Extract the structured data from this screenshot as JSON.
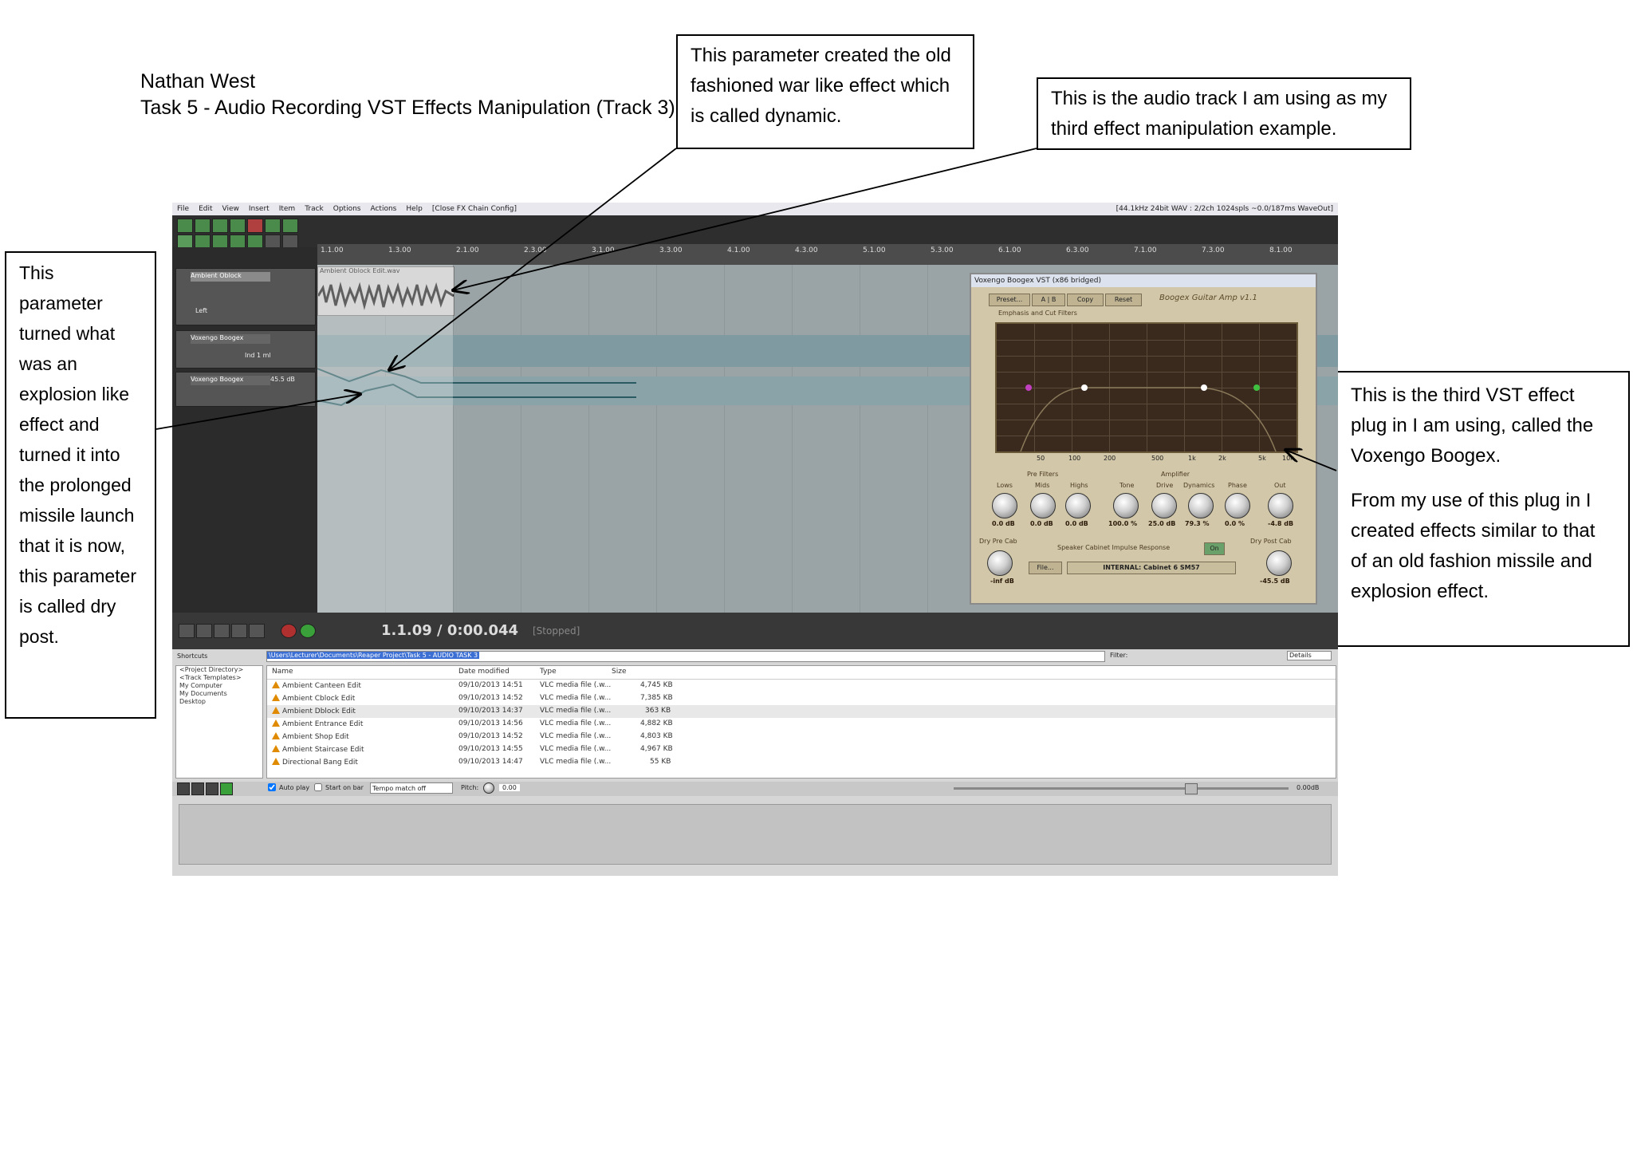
{
  "document": {
    "author": "Nathan West",
    "title": "Task 5 - Audio Recording VST Effects Manipulation (Track 3)"
  },
  "callouts": {
    "dynamic": "This parameter created the old fashioned war like effect which is called dynamic.",
    "audio_track": "This is the audio track I am using as my third effect manipulation example.",
    "dry_post": "This parameter turned what was an explosion like effect and turned it into the prolonged missile launch that it is now, this parameter is called dry post.",
    "plugin_1": "This is the third VST effect plug in I am using, called the Voxengo Boogex.",
    "plugin_2": "From my use of this plug in I created effects similar to that of an old fashion missile and explosion effect."
  },
  "screenshot": {
    "menu": [
      "File",
      "Edit",
      "View",
      "Insert",
      "Item",
      "Track",
      "Options",
      "Actions",
      "Help",
      "[Close FX Chain Config]"
    ],
    "status_right": "[44.1kHz 24bit WAV : 2/2ch 1024spls ~0.0/187ms WaveOut]",
    "ruler": [
      "1.1.00",
      "1.3.00",
      "2.1.00",
      "2.3.00",
      "3.1.00",
      "3.3.00",
      "4.1.00",
      "4.3.00",
      "5.1.00",
      "5.3.00",
      "6.1.00",
      "6.3.00",
      "7.1.00",
      "7.3.00",
      "8.1.00"
    ],
    "item_name": "Ambient Oblock Edit.wav",
    "tracks": [
      {
        "name": "Ambient Oblock",
        "pan": "Left"
      },
      {
        "name": "Voxengo Boogex",
        "value": "Ind 1 ml"
      },
      {
        "name": "Voxengo Boogex",
        "value": "45.5 dB"
      }
    ],
    "transport": {
      "time": "1.1.09 / 0:00.044",
      "status": "[Stopped]"
    },
    "plugin": {
      "title": "Voxengo Boogex VST (x86 bridged)",
      "buttons": [
        "Preset...",
        "A | B",
        "Copy",
        "Reset"
      ],
      "name": "Boogex Guitar Amp  v1.1",
      "section": "Emphasis and Cut Filters",
      "x_ticks": [
        "50",
        "100",
        "200",
        "500",
        "1k",
        "2k",
        "5k",
        "10k"
      ],
      "groups": [
        "Pre Filters",
        "Amplifier"
      ],
      "knobs": [
        {
          "label": "Lows",
          "value": "0.0 dB"
        },
        {
          "label": "Mids",
          "value": "0.0 dB"
        },
        {
          "label": "Highs",
          "value": "0.0 dB"
        },
        {
          "label": "Tone",
          "value": "100.0 %"
        },
        {
          "label": "Drive",
          "value": "25.0 dB"
        },
        {
          "label": "Dynamics",
          "value": "79.3 %"
        },
        {
          "label": "Phase",
          "value": "0.0 %"
        },
        {
          "label": "Out",
          "value": "-4.8 dB"
        }
      ],
      "dry_pre": {
        "label": "Dry Pre Cab",
        "value": "-inf dB"
      },
      "dry_post": {
        "label": "Dry Post Cab",
        "value": "-45.5 dB"
      },
      "speaker_label": "Speaker Cabinet Impulse Response",
      "speaker_toggle": "On",
      "file_button": "File...",
      "impulse": "INTERNAL: Cabinet 6 SM57"
    },
    "browser": {
      "shortcuts_label": "Shortcuts",
      "shortcuts": [
        "<Project Directory>",
        "<Track Templates>",
        "My Computer",
        "My Documents",
        "Desktop"
      ],
      "path": "\\Users\\Lecturer\\Documents\\Reaper Project\\Task 5 - AUDIO TASK 3",
      "filter_label": "Filter:",
      "view": "Details",
      "columns": [
        "Name",
        "Date modified",
        "Type",
        "Size"
      ],
      "files": [
        {
          "name": "Ambient Canteen Edit",
          "date": "09/10/2013 14:51",
          "type": "VLC media file (.w...",
          "size": "4,745 KB"
        },
        {
          "name": "Ambient Cblock Edit",
          "date": "09/10/2013 14:52",
          "type": "VLC media file (.w...",
          "size": "7,385 KB"
        },
        {
          "name": "Ambient Dblock Edit",
          "date": "09/10/2013 14:37",
          "type": "VLC media file (.w...",
          "size": "363 KB"
        },
        {
          "name": "Ambient Entrance Edit",
          "date": "09/10/2013 14:56",
          "type": "VLC media file (.w...",
          "size": "4,882 KB"
        },
        {
          "name": "Ambient Shop Edit",
          "date": "09/10/2013 14:52",
          "type": "VLC media file (.w...",
          "size": "4,803 KB"
        },
        {
          "name": "Ambient Staircase Edit",
          "date": "09/10/2013 14:55",
          "type": "VLC media file (.w...",
          "size": "4,967 KB"
        },
        {
          "name": "Directional Bang Edit",
          "date": "09/10/2013 14:47",
          "type": "VLC media file (.w...",
          "size": "55 KB"
        }
      ],
      "autoplay": "Auto play",
      "start_on_bar": "Start on bar",
      "tempo": "Tempo match off",
      "pitch_label": "Pitch:",
      "pitch": "0.00",
      "volume": "0.00dB"
    }
  }
}
